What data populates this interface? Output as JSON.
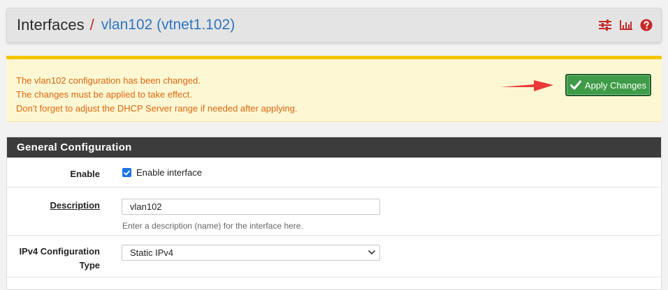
{
  "header": {
    "root": "Interfaces",
    "separator": "/",
    "current": "vlan102 (vtnet1.102)",
    "icons": [
      "settings-sliders-icon",
      "bar-chart-icon",
      "help-icon"
    ]
  },
  "alert": {
    "lines": [
      "The vlan102 configuration has been changed.",
      "The changes must be applied to take effect.",
      "Don't forget to adjust the DHCP Server range if needed after applying."
    ],
    "apply_label": "Apply Changes"
  },
  "panel": {
    "title": "General Configuration",
    "enable": {
      "label": "Enable",
      "checkbox_label": "Enable interface",
      "checked": true
    },
    "description": {
      "label": "Description",
      "value": "vlan102",
      "help": "Enter a description (name) for the interface here."
    },
    "ipv4": {
      "label": "IPv4 Configuration Type",
      "value": "Static IPv4"
    }
  },
  "colors": {
    "accent_red": "#c62828",
    "link_blue": "#2f76c0",
    "alert_text": "#e0650f",
    "alert_bg": "#fdf8d3",
    "apply_green": "#3e9b47"
  }
}
